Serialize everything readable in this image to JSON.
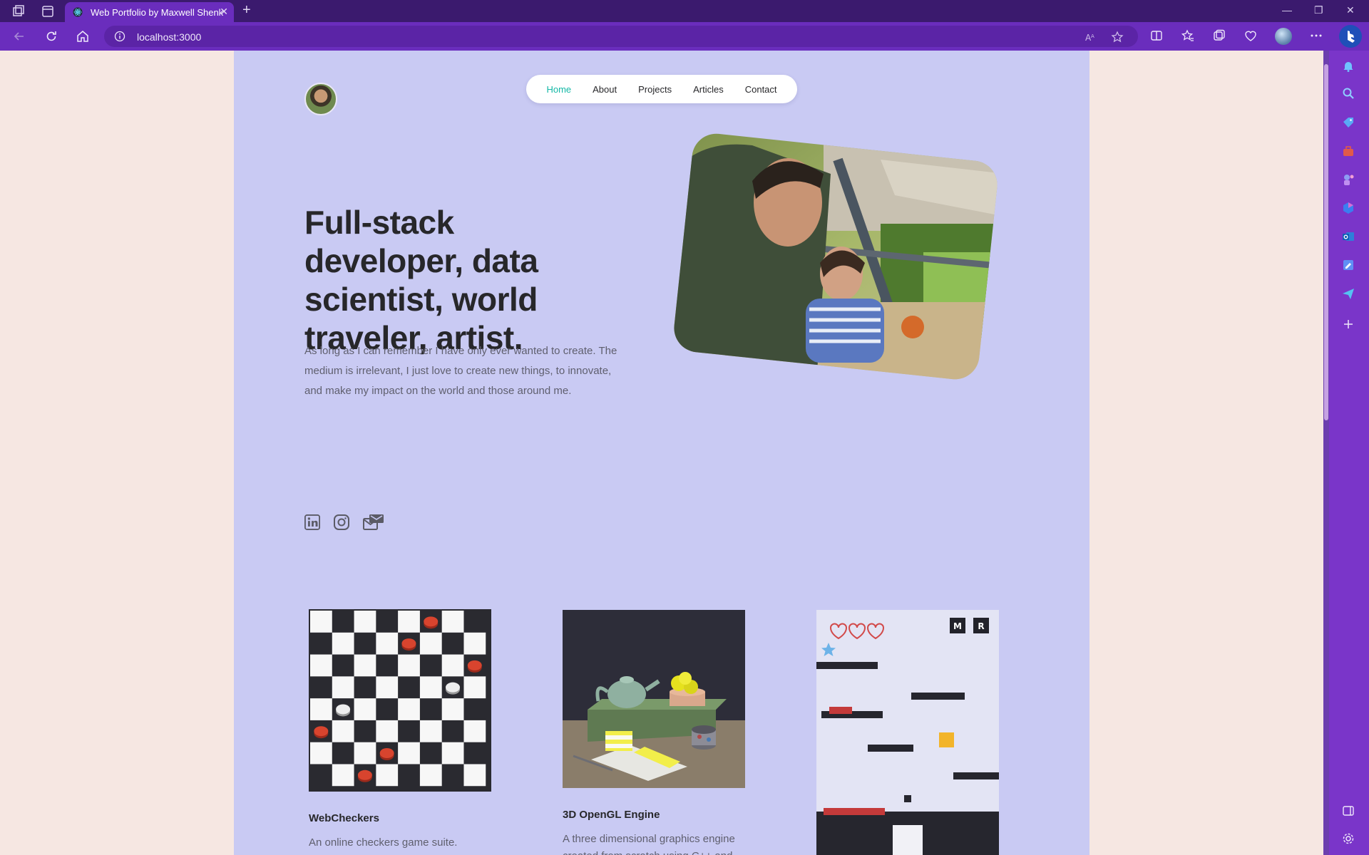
{
  "browser": {
    "tab_title": "Web Portfolio by Maxwell Shenk",
    "url": "localhost:3000"
  },
  "nav": {
    "items": [
      {
        "label": "Home",
        "active": true
      },
      {
        "label": "About",
        "active": false
      },
      {
        "label": "Projects",
        "active": false
      },
      {
        "label": "Articles",
        "active": false
      },
      {
        "label": "Contact",
        "active": false
      }
    ]
  },
  "hero": {
    "headline": "Full-stack developer, data scientist, world traveler, artist.",
    "intro": "As long as I can remember I have only ever wanted to create. The medium is irrelevant, I just love to create new things, to innovate, and make my impact on the world and those around me."
  },
  "social": [
    "linkedin-icon",
    "instagram-icon",
    "mail-icon"
  ],
  "projects": [
    {
      "title": "WebCheckers",
      "desc": "An online checkers game suite."
    },
    {
      "title": "3D OpenGL Engine",
      "desc": "A three dimensional graphics engine created from scratch using C++ and"
    },
    {
      "title": "",
      "desc": ""
    }
  ],
  "game_preview": {
    "buttons": [
      "M",
      "R"
    ],
    "hearts": 3
  },
  "colors": {
    "page_bg": "#c9caf3",
    "outer_bg": "#f6e7e2",
    "accent": "#14b8a6",
    "heading": "#27272a",
    "browser_purple": "#6a2dbd"
  }
}
